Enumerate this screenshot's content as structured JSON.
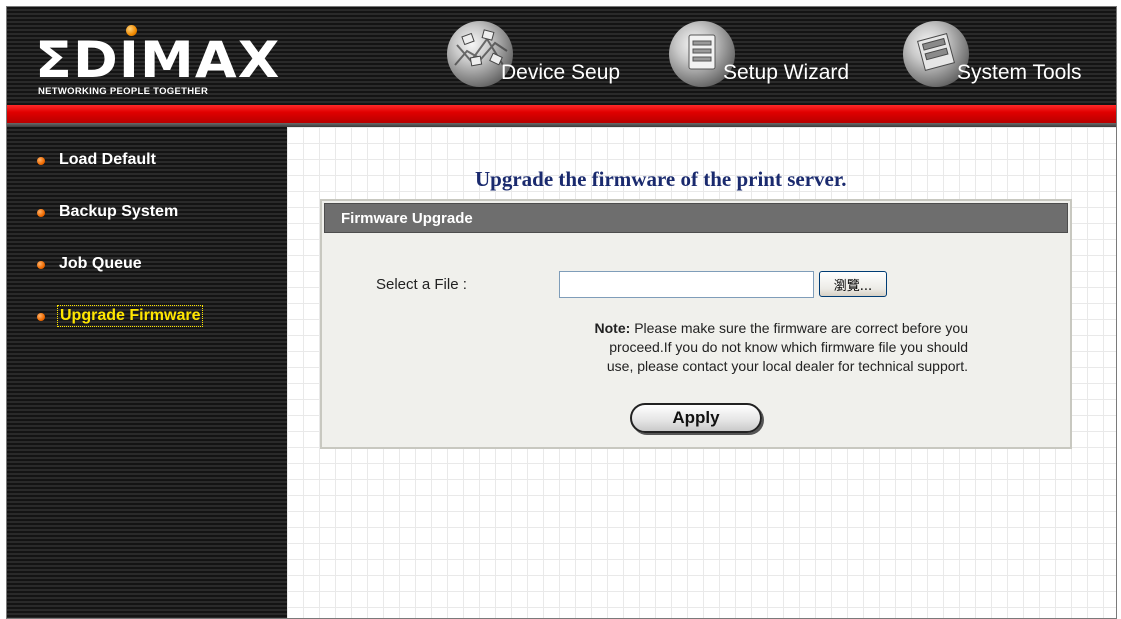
{
  "logo": {
    "word": "ΣDIMAX",
    "tagline": "NETWORKING PEOPLE TOGETHER"
  },
  "top_nav": [
    {
      "label": "Device Seup",
      "icon": "network-globe-icon"
    },
    {
      "label": "Setup Wizard",
      "icon": "setup-globe-icon"
    },
    {
      "label": "System Tools",
      "icon": "tools-globe-icon"
    }
  ],
  "sidebar": {
    "items": [
      {
        "label": "Load Default"
      },
      {
        "label": "Backup System"
      },
      {
        "label": "Job Queue"
      },
      {
        "label": "Upgrade Firmware",
        "active": true
      }
    ]
  },
  "main": {
    "title": "Upgrade the firmware of the print server.",
    "panel": {
      "heading": "Firmware Upgrade",
      "file_label": "Select a File :",
      "file_value": "",
      "browse_label": "瀏覽...",
      "note_prefix": "Note:",
      "note_lines": [
        "Please make sure the firmware are correct before you",
        "proceed.If you do not know which firmware file you should",
        "use, please contact your local dealer for technical support."
      ],
      "apply_label": "Apply"
    }
  },
  "colors": {
    "title_text": "#1a2a6e",
    "accent_red": "#e00000",
    "active_item": "#ffe600",
    "bullet": "#f06a00"
  }
}
